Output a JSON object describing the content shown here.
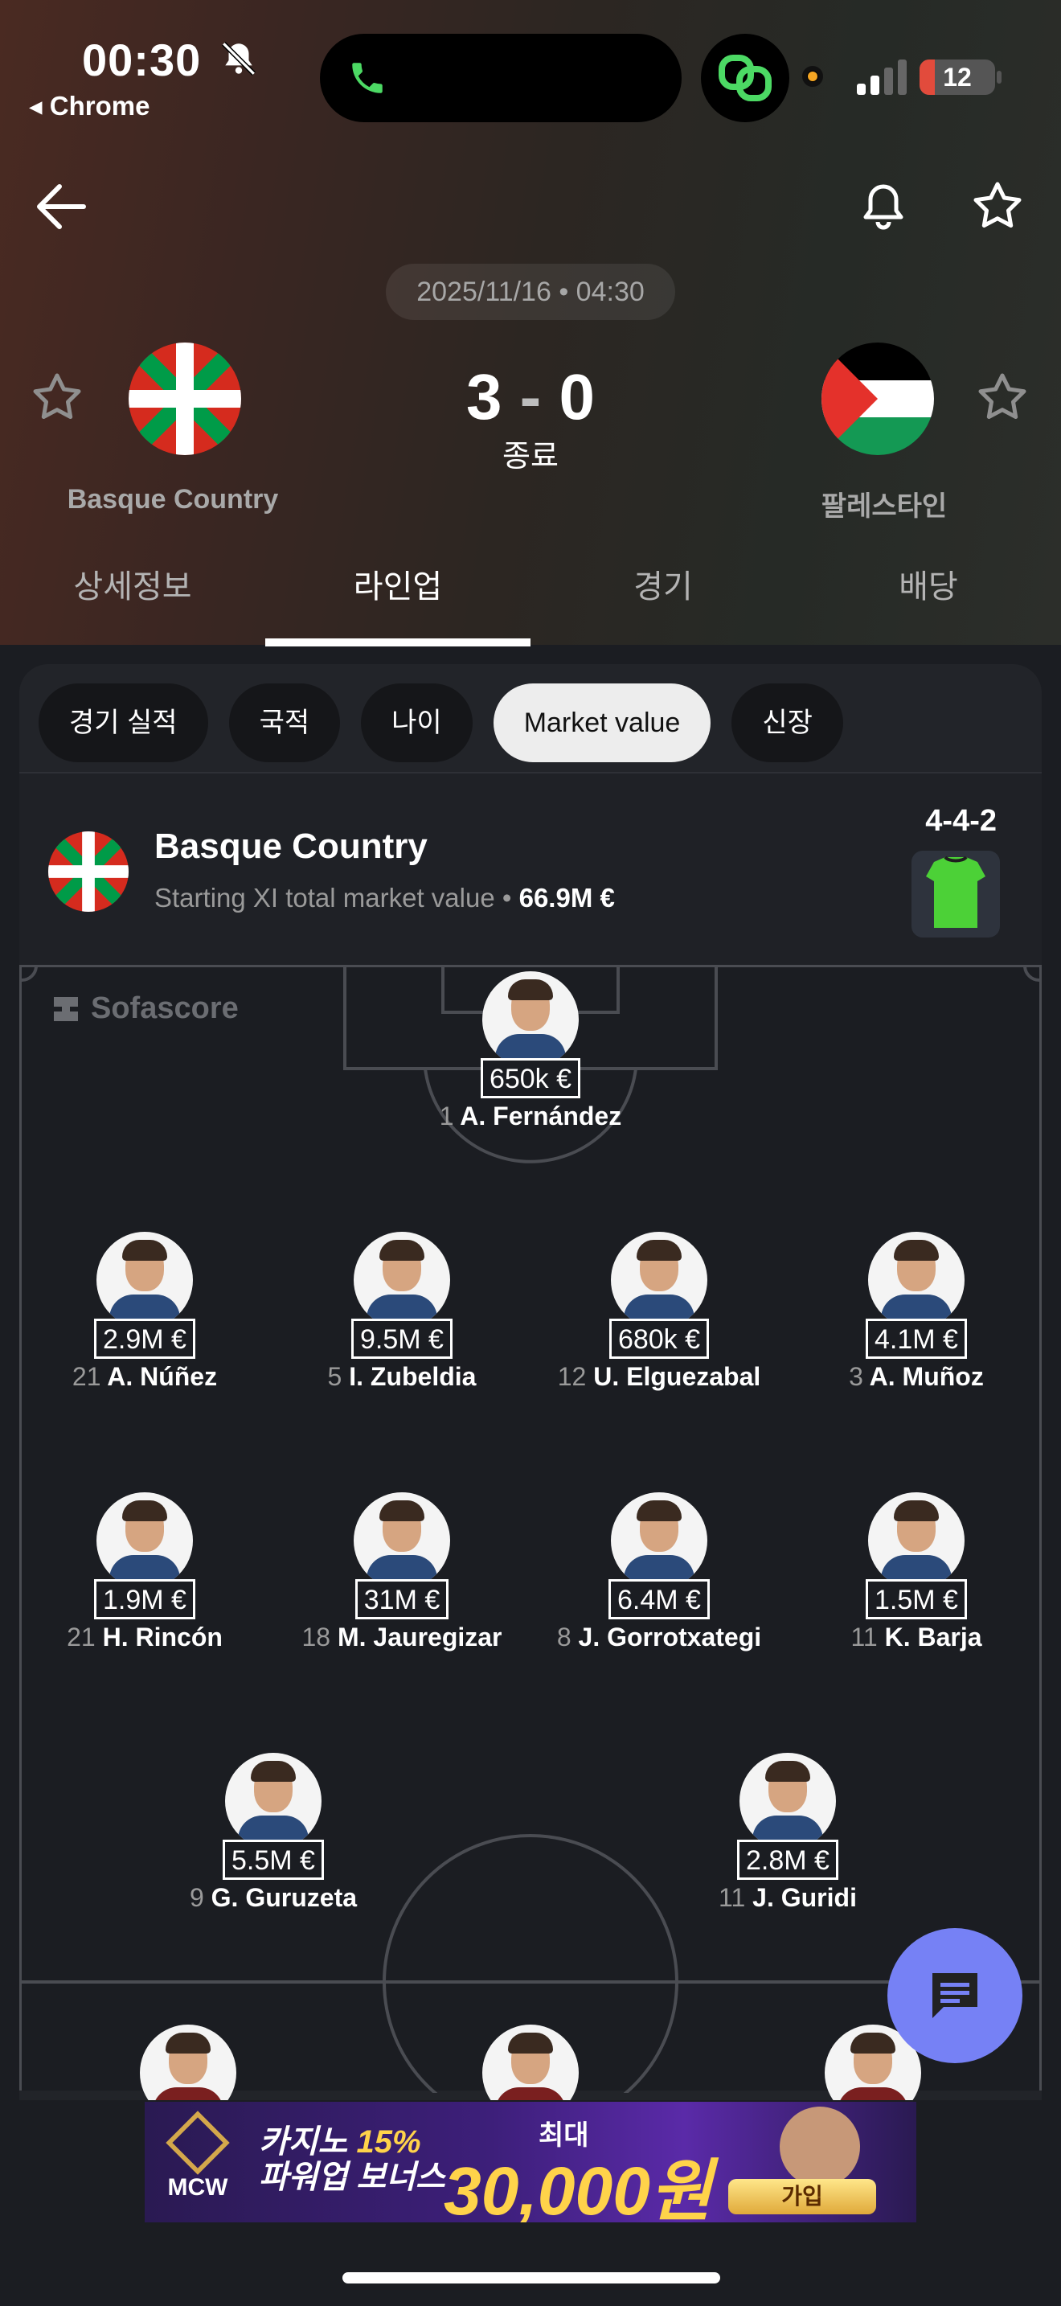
{
  "status_bar": {
    "time": "00:30",
    "back_app": "◂ Chrome",
    "battery": "12"
  },
  "match": {
    "date": "2025/11/16 • 04:30",
    "home_team": "Basque Country",
    "away_team": "팔레스타인",
    "home_score": "3",
    "away_score": "0",
    "score_separator": "-",
    "status": "종료"
  },
  "tabs": [
    "상세정보",
    "라인업",
    "경기",
    "배당"
  ],
  "active_tab": "라인업",
  "chips": [
    "경기 실적",
    "국적",
    "나이",
    "Market value",
    "신장"
  ],
  "active_chip": "Market value",
  "lineup": {
    "team": "Basque Country",
    "subtitle_label": "Starting XI total market value • ",
    "subtitle_value": "66.9M €",
    "formation": "4-4-2",
    "watermark": "Sofascore"
  },
  "players": {
    "gk": {
      "value": "650k €",
      "number": "1",
      "name": "A. Fernández"
    },
    "def": [
      {
        "value": "2.9M €",
        "number": "21",
        "name": "A. Núñez"
      },
      {
        "value": "9.5M €",
        "number": "5",
        "name": "I. Zubeldia"
      },
      {
        "value": "680k €",
        "number": "12",
        "name": "U. Elguezabal"
      },
      {
        "value": "4.1M €",
        "number": "3",
        "name": "A. Muñoz"
      }
    ],
    "mid": [
      {
        "value": "1.9M €",
        "number": "21",
        "name": "H. Rincón"
      },
      {
        "value": "31M €",
        "number": "18",
        "name": "M. Jauregizar"
      },
      {
        "value": "6.4M €",
        "number": "8",
        "name": "J. Gorrotxategi"
      },
      {
        "value": "1.5M €",
        "number": "11",
        "name": "K. Barja"
      }
    ],
    "fwd": [
      {
        "value": "5.5M €",
        "number": "9",
        "name": "G. Guruzeta"
      },
      {
        "value": "2.8M €",
        "number": "11",
        "name": "J. Guridi"
      }
    ]
  },
  "ad": {
    "brand": "MCW",
    "line1_a": "카지노 ",
    "line1_b": "15%",
    "line2": "파워업 보너스",
    "max_label": "최대",
    "amount": "30,000원",
    "join": "가입"
  },
  "colors": {
    "accent_fab": "#7681f5",
    "battery_low": "#e24b3c",
    "jersey": "#4cd137"
  }
}
